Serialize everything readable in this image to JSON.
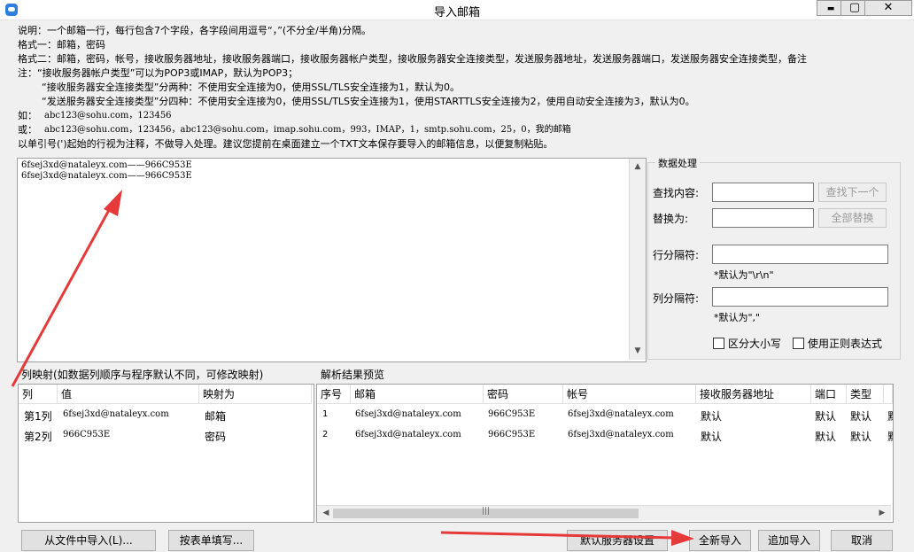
{
  "window": {
    "title": "导入邮箱",
    "icons": [
      "app-icon",
      "minimize-icon",
      "maximize-icon",
      "close-icon"
    ],
    "controls": {
      "minimize": "▬",
      "maximize": "▢",
      "close": "✕"
    }
  },
  "instructions": {
    "line1": "说明：一个邮箱一行，每行包含7个字段，各字段间用逗号“，”(不分全/半角)分隔。",
    "line2": "格式一：邮箱，密码",
    "line3": "格式二：邮箱，密码，帐号，接收服务器地址，接收服务器端口，接收服务器帐户类型，接收服务器安全连接类型，发送服务器地址，发送服务器端口，发送服务器安全连接类型，备注",
    "line4": "注：“接收服务器帐户类型”可以为POP3或IMAP，默认为POP3；",
    "line5": "“接收服务器安全连接类型”分两种：不使用安全连接为0，使用SSL/TLS安全连接为1，默认为0。",
    "line6": "“发送服务器安全连接类型”分四种：不使用安全连接为0，使用SSL/TLS安全连接为1，使用STARTTLS安全连接为2，使用自动安全连接为3，默认为0。",
    "example1_label": "如：",
    "example1": "abc123@sohu.com，123456",
    "example2_label": "或：",
    "example2": "abc123@sohu.com，123456，abc123@sohu.com，imap.sohu.com，993，IMAP，1，smtp.sohu.com，25，0，我的邮箱",
    "line9": "以单引号(')起始的行视为注释，不做导入处理。建议您提前在桌面建立一个TXT文本保存要导入的邮箱信息，以便复制粘贴。"
  },
  "input_text": {
    "lines": [
      "6fsej3xd@nataleyx.com——966C953E",
      "6fsej3xd@nataleyx.com——966C953E"
    ]
  },
  "data_processing": {
    "title": "数据处理",
    "find_label": "查找内容:",
    "find_value": "",
    "find_next_button": "查找下一个",
    "replace_label": "替换为:",
    "replace_value": "",
    "replace_all_button": "全部替换",
    "row_sep_label": "行分隔符:",
    "row_sep_value": "",
    "row_sep_hint": "*默认为\"\\r\\n\"",
    "col_sep_label": "列分隔符:",
    "col_sep_value": "",
    "col_sep_hint": "*默认为\",\"",
    "case_sensitive_label": "区分大小写",
    "regex_label": "使用正则表达式"
  },
  "column_mapping": {
    "title": "列映射(如数据列顺序与程序默认不同，可修改映射)",
    "headers": [
      "列",
      "值",
      "映射为"
    ],
    "rows": [
      {
        "col": "第1列",
        "value": "6fsej3xd@nataleyx.com",
        "map": "邮箱"
      },
      {
        "col": "第2列",
        "value": "966C953E",
        "map": "密码"
      }
    ]
  },
  "preview": {
    "title": "解析结果预览",
    "headers": [
      "序号",
      "邮箱",
      "密码",
      "帐号",
      "接收服务器地址",
      "端口",
      "类型",
      ""
    ],
    "rows": [
      {
        "no": "1",
        "email": "6fsej3xd@nataleyx.com",
        "password": "966C953E",
        "account": "6fsej3xd@nataleyx.com",
        "server": "默认",
        "port": "默认",
        "type": "默认",
        "extra": "默"
      },
      {
        "no": "2",
        "email": "6fsej3xd@nataleyx.com",
        "password": "966C953E",
        "account": "6fsej3xd@nataleyx.com",
        "server": "默认",
        "port": "默认",
        "type": "默认",
        "extra": "默"
      }
    ]
  },
  "footer": {
    "import_from_file": "从文件中导入(L)...",
    "fill_form": "按表单填写...",
    "default_server_settings": "默认服务器设置",
    "new_import": "全新导入",
    "append_import": "追加导入",
    "cancel": "取消"
  },
  "annotation_color": "#e5393a"
}
